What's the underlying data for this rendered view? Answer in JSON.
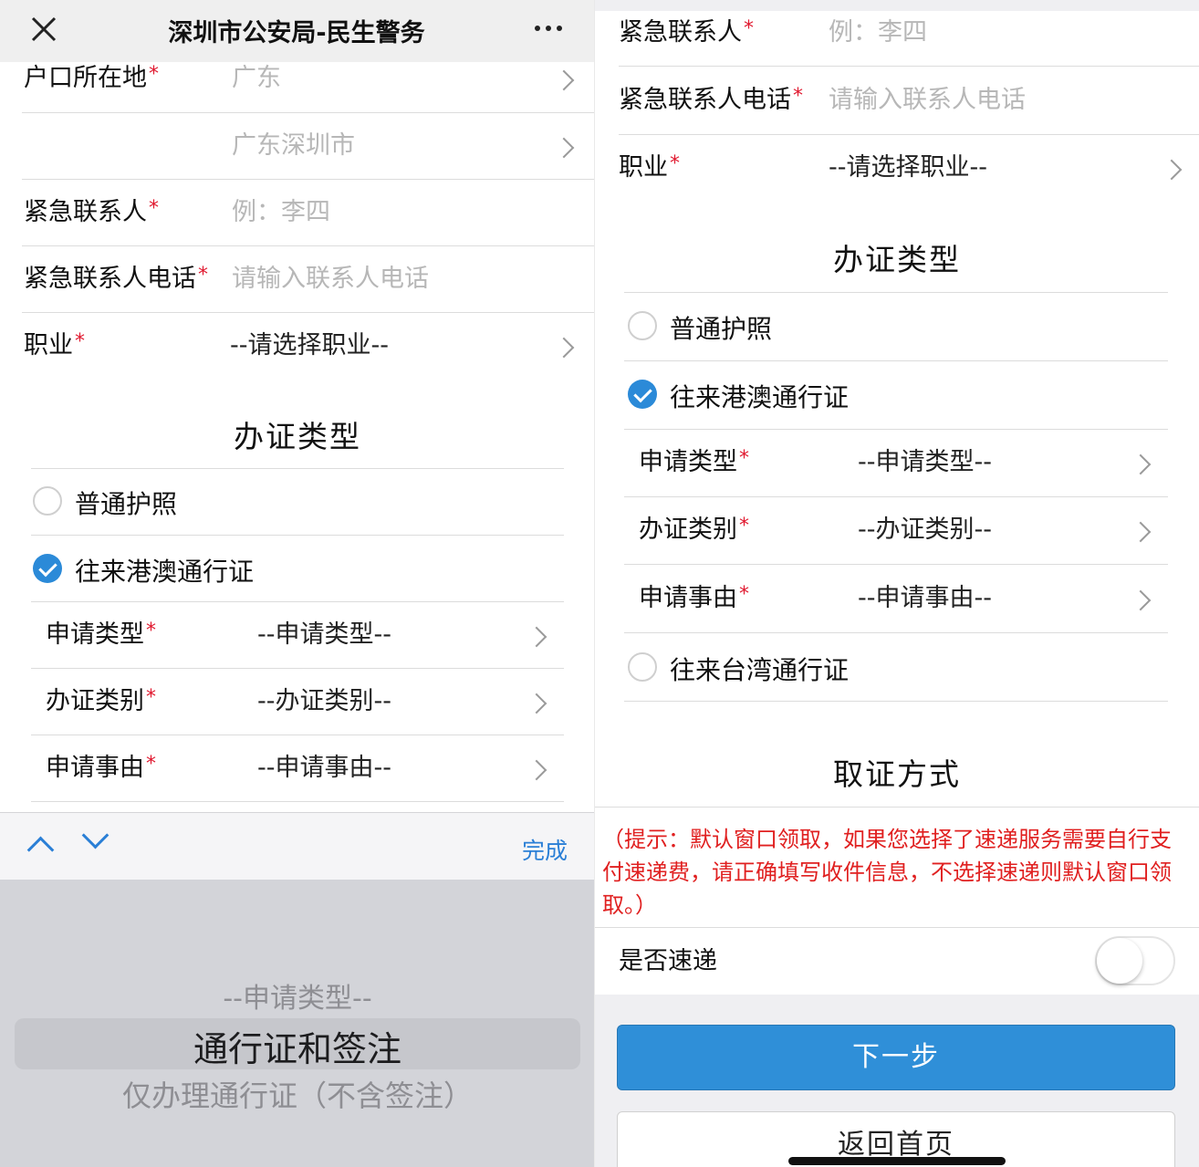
{
  "nav": {
    "title": "深圳市公安局-民生警务"
  },
  "form": {
    "residence_label": "户口所在地",
    "residence_province": "广东",
    "residence_city": "广东深圳市",
    "contact_label": "紧急联系人",
    "contact_placeholder": "例：李四",
    "phone_label": "紧急联系人电话",
    "phone_placeholder": "请输入联系人电话",
    "occupation_label": "职业",
    "occupation_value": "--请选择职业--",
    "required_mark": "*"
  },
  "cert_section": {
    "title": "办证类型",
    "options": [
      {
        "label": "普通护照",
        "checked": false
      },
      {
        "label": "往来港澳通行证",
        "checked": true
      },
      {
        "label": "往来台湾通行证",
        "checked": false
      }
    ],
    "sub_fields": [
      {
        "label": "申请类型",
        "value": "--申请类型--"
      },
      {
        "label": "办证类别",
        "value": "--办证类别--"
      },
      {
        "label": "申请事由",
        "value": "--申请事由--"
      }
    ]
  },
  "keyboard": {
    "done_label": "完成"
  },
  "picker": {
    "options": [
      "--申请类型--",
      "通行证和签注",
      "仅办理通行证（不含签注）"
    ],
    "selected": "通行证和签注"
  },
  "pickup_section": {
    "title": "取证方式",
    "notice": "（提示：默认窗口领取，如果您选择了速递服务需要自行支付速递费，请正确填写收件信息，不选择速递则默认窗口领取。）",
    "express_label": "是否速递",
    "express_on": false
  },
  "buttons": {
    "next": "下一步",
    "home": "返回首页"
  },
  "colors": {
    "accent": "#2f8fd8",
    "required": "#e0192f",
    "notice": "#e02020"
  }
}
